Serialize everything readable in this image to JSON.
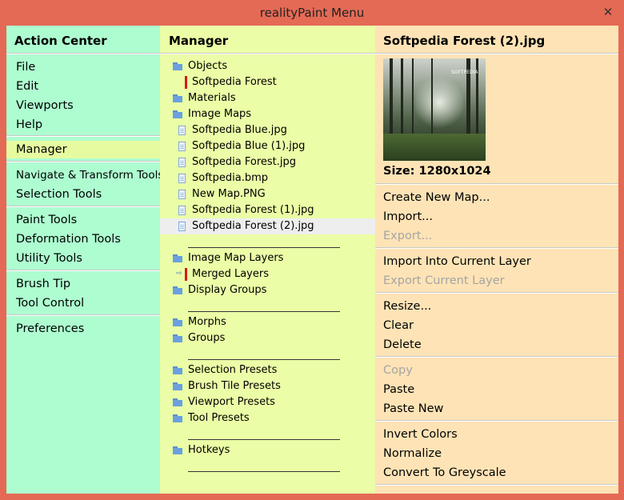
{
  "window": {
    "title": "realityPaint Menu",
    "close_glyph": "✕"
  },
  "colors": {
    "frame": "#e46a55",
    "col1_bg": "#aefdd0",
    "col2_bg": "#ebfda6",
    "col3_bg": "#fee3b6"
  },
  "action_center": {
    "heading": "Action Center",
    "items": [
      "File",
      "Edit",
      "Viewports",
      "Help",
      "Manager",
      "Navigate & Transform Tools",
      "Selection Tools",
      "Paint Tools",
      "Deformation Tools",
      "Utility Tools",
      "Brush Tip",
      "Tool Control",
      "Preferences"
    ],
    "selected": "Manager"
  },
  "manager": {
    "heading": "Manager",
    "tree": [
      {
        "label": "Objects",
        "icon": "folder-icon"
      },
      {
        "label": "Softpedia Forest",
        "icon": "red-marker-icon"
      },
      {
        "label": "Materials",
        "icon": "folder-icon"
      },
      {
        "label": "Image Maps",
        "icon": "folder-icon"
      },
      {
        "label": "Softpedia Blue.jpg",
        "icon": "document-icon"
      },
      {
        "label": "Softpedia Blue (1).jpg",
        "icon": "document-icon"
      },
      {
        "label": "Softpedia Forest.jpg",
        "icon": "document-icon"
      },
      {
        "label": "Softpedia.bmp",
        "icon": "document-icon"
      },
      {
        "label": "New Map.PNG",
        "icon": "document-icon"
      },
      {
        "label": "Softpedia Forest (1).jpg",
        "icon": "document-icon"
      },
      {
        "label": "Softpedia Forest (2).jpg",
        "icon": "document-icon"
      },
      {
        "label": "Image Map Layers",
        "icon": "folder-icon"
      },
      {
        "label": "Merged Layers",
        "icon": "red-marker-icon"
      },
      {
        "label": "Display Groups",
        "icon": "folder-icon"
      },
      {
        "label": "Morphs",
        "icon": "folder-icon"
      },
      {
        "label": "Groups",
        "icon": "folder-icon"
      },
      {
        "label": "Selection Presets",
        "icon": "folder-icon"
      },
      {
        "label": "Brush Tile Presets",
        "icon": "folder-icon"
      },
      {
        "label": "Viewport Presets",
        "icon": "folder-icon"
      },
      {
        "label": "Tool Presets",
        "icon": "folder-icon"
      },
      {
        "label": "Hotkeys",
        "icon": "folder-icon"
      }
    ],
    "selected": "Softpedia Forest (2).jpg"
  },
  "details": {
    "heading": "Softpedia Forest (2).jpg",
    "thumbnail_logo": "SOFTPEDIA",
    "size_label": "Size: 1280x1024",
    "actions": [
      {
        "label": "Create New Map...",
        "enabled": true
      },
      {
        "label": "Import...",
        "enabled": true
      },
      {
        "label": "Export...",
        "enabled": false
      },
      {
        "label": "Import Into Current Layer",
        "enabled": true
      },
      {
        "label": "Export Current Layer",
        "enabled": false
      },
      {
        "label": "Resize...",
        "enabled": true
      },
      {
        "label": "Clear",
        "enabled": true
      },
      {
        "label": "Delete",
        "enabled": true
      },
      {
        "label": "Copy",
        "enabled": false
      },
      {
        "label": "Paste",
        "enabled": true
      },
      {
        "label": "Paste New",
        "enabled": true
      },
      {
        "label": "Invert Colors",
        "enabled": true
      },
      {
        "label": "Normalize",
        "enabled": true
      },
      {
        "label": "Convert To Greyscale",
        "enabled": true
      }
    ]
  }
}
